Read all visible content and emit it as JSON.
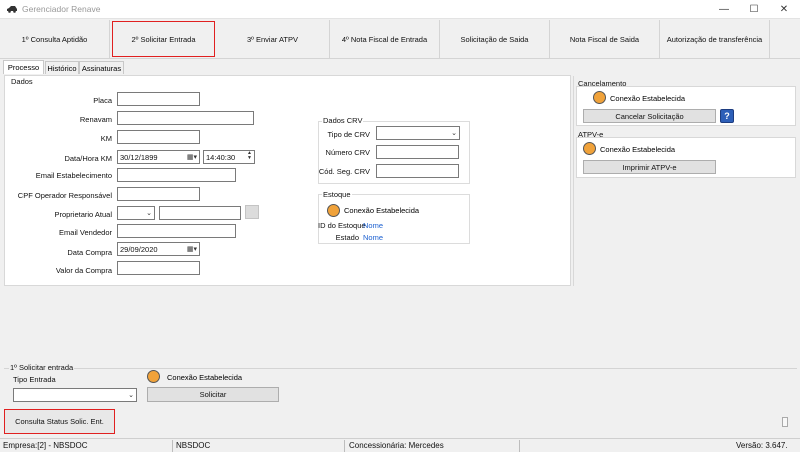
{
  "window": {
    "title": "Gerenciador Renave",
    "minimize": "—",
    "maximize": "☐",
    "close": "✕"
  },
  "top_tabs": [
    "1º Consulta Aptidão",
    "2º Solicitar Entrada",
    "3º Enviar ATPV",
    "4º Nota Fiscal de Entrada",
    "Solicitação de Saida",
    "Nota Fiscal de Saida",
    "Autorização de transferência"
  ],
  "sub_tabs": [
    "Processo",
    "Histórico",
    "Assinaturas"
  ],
  "dados": {
    "title": "Dados",
    "placa": {
      "label": "Placa",
      "value": ""
    },
    "renavam": {
      "label": "Renavam",
      "value": ""
    },
    "km": {
      "label": "KM",
      "value": ""
    },
    "data_hora_km": {
      "label": "Data/Hora KM",
      "date": "30/12/1899",
      "time": "14:40:30"
    },
    "email_estabelecimento": {
      "label": "Email Estabelecimento",
      "value": ""
    },
    "cpf_operador": {
      "label": "CPF Operador Responsável",
      "value": ""
    },
    "proprietario_atual": {
      "label": "Proprietario Atual",
      "value": ""
    },
    "email_vendedor": {
      "label": "Email Vendedor",
      "value": ""
    },
    "data_compra": {
      "label": "Data Compra",
      "value": "29/09/2020"
    },
    "valor_compra": {
      "label": "Valor da Compra",
      "value": ""
    }
  },
  "dados_crv": {
    "title": "Dados CRV",
    "tipo_crv": {
      "label": "Tipo de CRV",
      "value": ""
    },
    "numero_crv": {
      "label": "Número CRV",
      "value": ""
    },
    "cod_seg_crv": {
      "label": "Cód. Seg. CRV",
      "value": ""
    }
  },
  "estoque": {
    "title": "Estoque",
    "status": "Conexão Estabelecida",
    "id_label": "ID do Estoque",
    "id_value": "Nome",
    "estado_label": "Estado",
    "estado_value": "Nome"
  },
  "cancelamento": {
    "title": "Cancelamento",
    "status": "Conexão Estabelecida",
    "button": "Cancelar Solicitação",
    "help": "?"
  },
  "atpv": {
    "title": "ATPV-e",
    "status": "Conexão Estabelecida",
    "button": "Imprimir ATPV-e"
  },
  "solicitar": {
    "title": "1º Solicitar entrada",
    "tipo_label": "Tipo Entrada",
    "tipo_value": "",
    "status": "Conexão Estabelecida",
    "button": "Solicitar"
  },
  "consulta_button": "Consulta Status Solic. Ent.",
  "status_bar": {
    "empresa": "Empresa:[2] - NBSDOC",
    "user": "NBSDOC",
    "concessionaria": "Concessionária: Mercedes",
    "versao": "Versão: 3.647."
  },
  "colors": {
    "status_dot": "#f0a23a",
    "highlight_red": "#e02020",
    "link_blue": "#1a5fd0"
  }
}
